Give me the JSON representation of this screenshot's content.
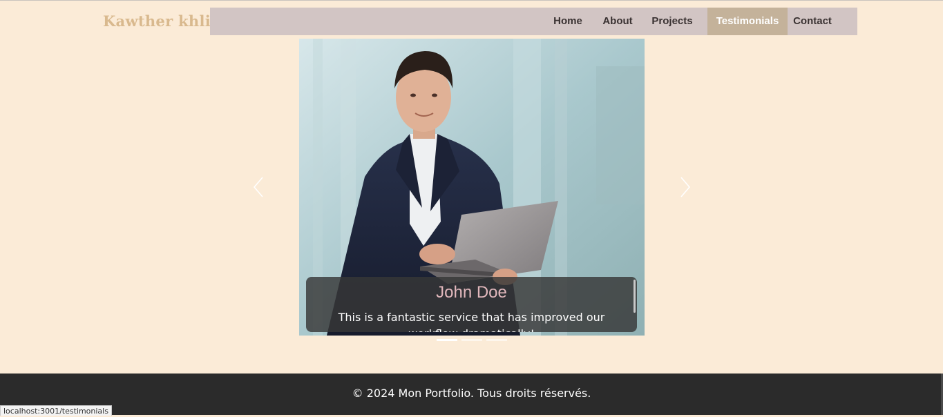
{
  "header": {
    "brand": "Kawther khlif"
  },
  "nav": {
    "items": [
      {
        "label": "Home",
        "active": false
      },
      {
        "label": "About",
        "active": false
      },
      {
        "label": "Projects",
        "active": false
      },
      {
        "label": "Testimonials",
        "active": true
      },
      {
        "label": "Contact",
        "active": false
      }
    ]
  },
  "testimonial": {
    "name": "John Doe",
    "quote": "This is a fantastic service that has improved our workflow dramatically!",
    "slide_count": 3,
    "active_slide": 1
  },
  "footer": {
    "copyright": "© 2024 Mon Portfolio. Tous droits réservés."
  },
  "status_bar": {
    "url": "localhost:3001/testimonials"
  },
  "colors": {
    "background": "#fbebd7",
    "brand": "#d9b98e",
    "nav_bg": "#d2c5c4",
    "nav_active_bg": "#c4b29a",
    "footer_bg": "#2b2b2b",
    "caption_name": "#e2b8bd"
  },
  "icons": {
    "prev": "chevron-left-icon",
    "next": "chevron-right-icon"
  }
}
